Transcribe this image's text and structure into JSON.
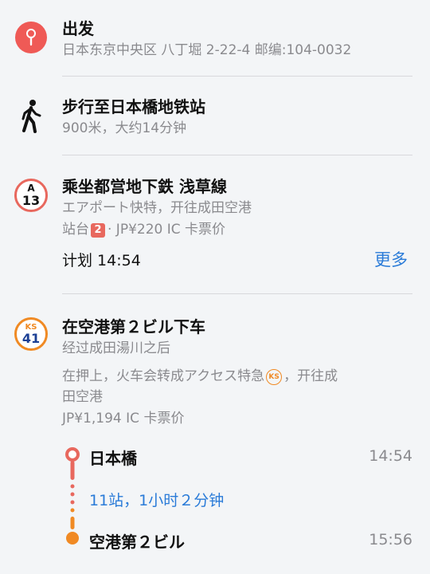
{
  "departure": {
    "title": "出发",
    "address": "日本东京中央区 八丁堀 2-22-4 邮编:104-0032"
  },
  "walk": {
    "title": "步行至日本橋地铁站",
    "detail": "900米，大约14分钟"
  },
  "train": {
    "badge_line": "A",
    "badge_num": "13",
    "title": "乘坐都営地下鉄 浅草線",
    "direction": "エアポート快特，开往成田空港",
    "platform_label": "站台",
    "platform_num": "2",
    "fare": "· JP¥220 IC 卡票价",
    "schedule": "计划 14:54",
    "more_label": "更多"
  },
  "getoff": {
    "badge_line": "KS",
    "badge_num": "41",
    "title": "在空港第２ビル下车",
    "after": "经过成田湯川之后",
    "note_part1": "在押上，火车会转成アクセス特急",
    "note_ks": "KS",
    "note_part2": "，开往成",
    "note_line2": "田空港",
    "fare": "JP¥1,194 IC 卡票价"
  },
  "timeline": {
    "start_name": "日本橋",
    "start_time": "14:54",
    "stops_summary": "11站，1小时２分钟",
    "end_name": "空港第２ビル",
    "end_time": "15:56"
  },
  "colors": {
    "accent_red": "#e8685e",
    "ks_orange": "#f08a24",
    "ks_blue": "#1b3f94",
    "link_blue": "#2a7bd8"
  }
}
